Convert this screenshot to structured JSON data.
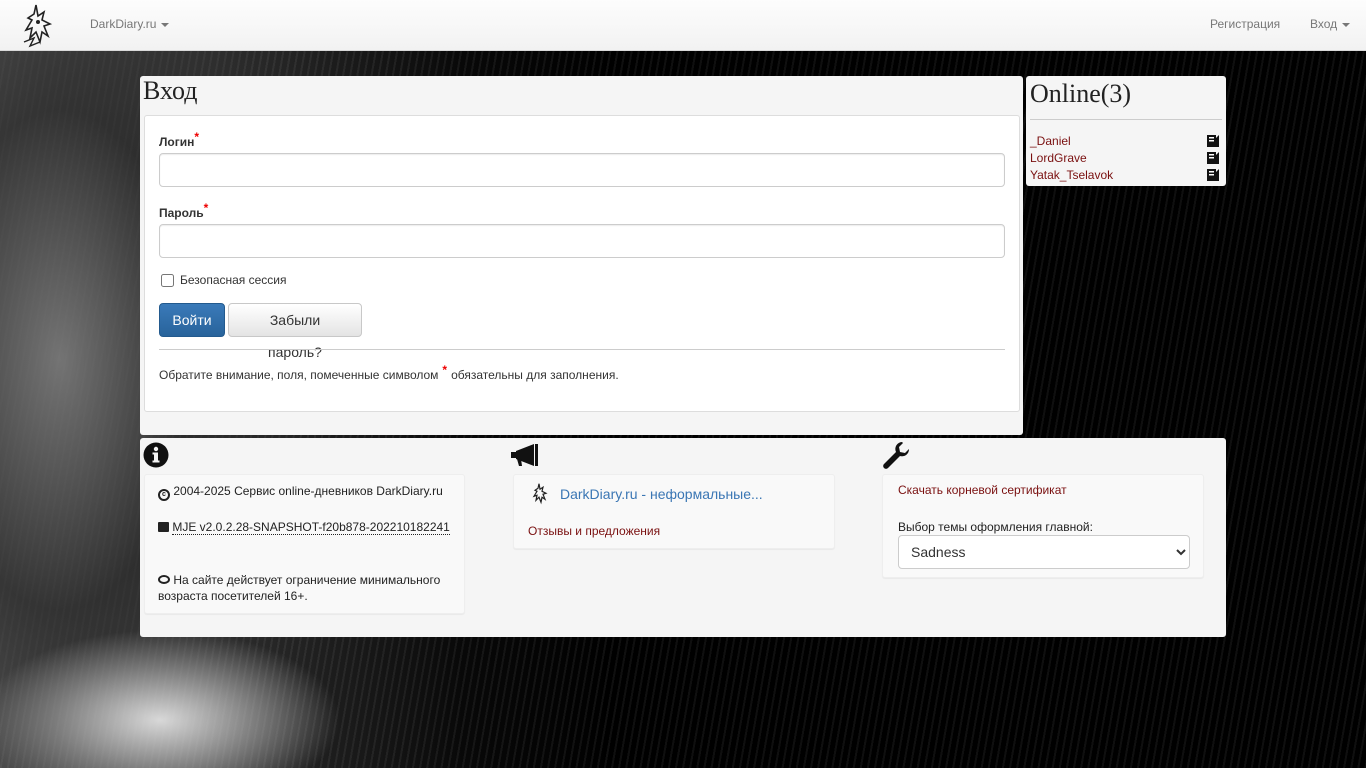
{
  "navbar": {
    "brand": "DarkDiary.ru",
    "register": "Регистрация",
    "login_menu": "Вход"
  },
  "login": {
    "title": "Вход",
    "login_label": "Логин",
    "password_label": "Пароль",
    "required_mark": "*",
    "login_value": "",
    "password_value": "",
    "secure_session_label": "Безопасная сессия",
    "secure_session_checked": false,
    "submit_label": "Войти",
    "forgot_label": "Забыли пароль?",
    "notice_before": "Обратите внимание, поля, помеченные символом",
    "notice_after": "обязательны для заполнения."
  },
  "online": {
    "title": "Online(3)",
    "users": [
      "_Daniel",
      "LordGrave",
      "Yatak_Tselavok"
    ]
  },
  "footer": {
    "copyright": "2004-2025 Сервис online-дневников DarkDiary.ru",
    "version": "MJE v2.0.2.28-SNAPSHOT-f20b878-202210182241",
    "age_notice": "На сайте действует ограничение минимального возраста посетителей 16+.",
    "announce_link": "DarkDiary.ru - неформальные...",
    "feedback_link": "Отзывы и предложения",
    "cert_link": "Скачать корневой сертификат",
    "theme_label": "Выбор темы оформления главной:",
    "theme_selected": "Sadness"
  },
  "colors": {
    "link_red": "#7a1010",
    "link_blue": "#3a76b4",
    "primary_button": "#28639b",
    "required": "#e00000"
  }
}
